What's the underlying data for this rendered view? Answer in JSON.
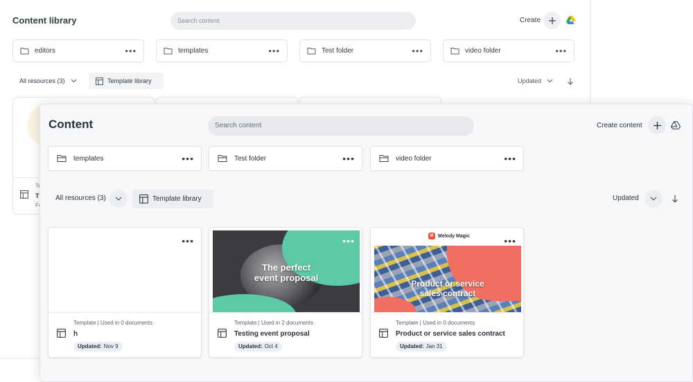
{
  "back_window": {
    "title": "Content library",
    "search_placeholder": "Search content",
    "create_label": "Create",
    "folders": [
      {
        "name": "editors"
      },
      {
        "name": "templates"
      },
      {
        "name": "Test folder"
      },
      {
        "name": "video folder"
      }
    ],
    "all_resources_label": "All resources (3)",
    "template_library_label": "Template library",
    "sort_label": "Updated",
    "partial_card": {
      "meta": "Te",
      "name": "Th",
      "updated": "Fe"
    }
  },
  "front_window": {
    "title": "Content",
    "search_placeholder": "Search content",
    "create_label": "Create content",
    "folders": [
      {
        "name": "templates"
      },
      {
        "name": "Test folder"
      },
      {
        "name": "video folder"
      }
    ],
    "all_resources_label": "All resources (3)",
    "template_library_label": "Template library",
    "sort_label": "Updated",
    "cards": [
      {
        "meta": "Template | Used in 0 documents",
        "name": "h",
        "updated_label": "Updated:",
        "updated_value": "Nov 9",
        "thumbnail": "blank"
      },
      {
        "meta": "Template | Used in 2 documents",
        "name": "Testing event proposal",
        "updated_label": "Updated:",
        "updated_value": "Oct 4",
        "thumbnail": "photo",
        "thumb_caption_1": "The perfect",
        "thumb_caption_2": "event proposal"
      },
      {
        "meta": "Template | Used in 0 documents",
        "name": "Product or service sales contract",
        "updated_label": "Updated:",
        "updated_value": "Jan 31",
        "thumbnail": "brand",
        "brand_name": "Melody Magic",
        "brand_mark": "M",
        "thumb_caption_1": "Product or service",
        "thumb_caption_2": "sales contract"
      }
    ]
  },
  "icons": [
    "folder-icon",
    "more-dots-icon",
    "plus-icon",
    "google-drive-icon",
    "chevron-down-icon",
    "sort-arrow-icon",
    "template-icon"
  ],
  "colors": {
    "accent_teal": "#5cc9a7",
    "accent_coral": "#ef6f62",
    "pill_bg": "#e9eef7",
    "search_bg": "#e7e9ed"
  }
}
